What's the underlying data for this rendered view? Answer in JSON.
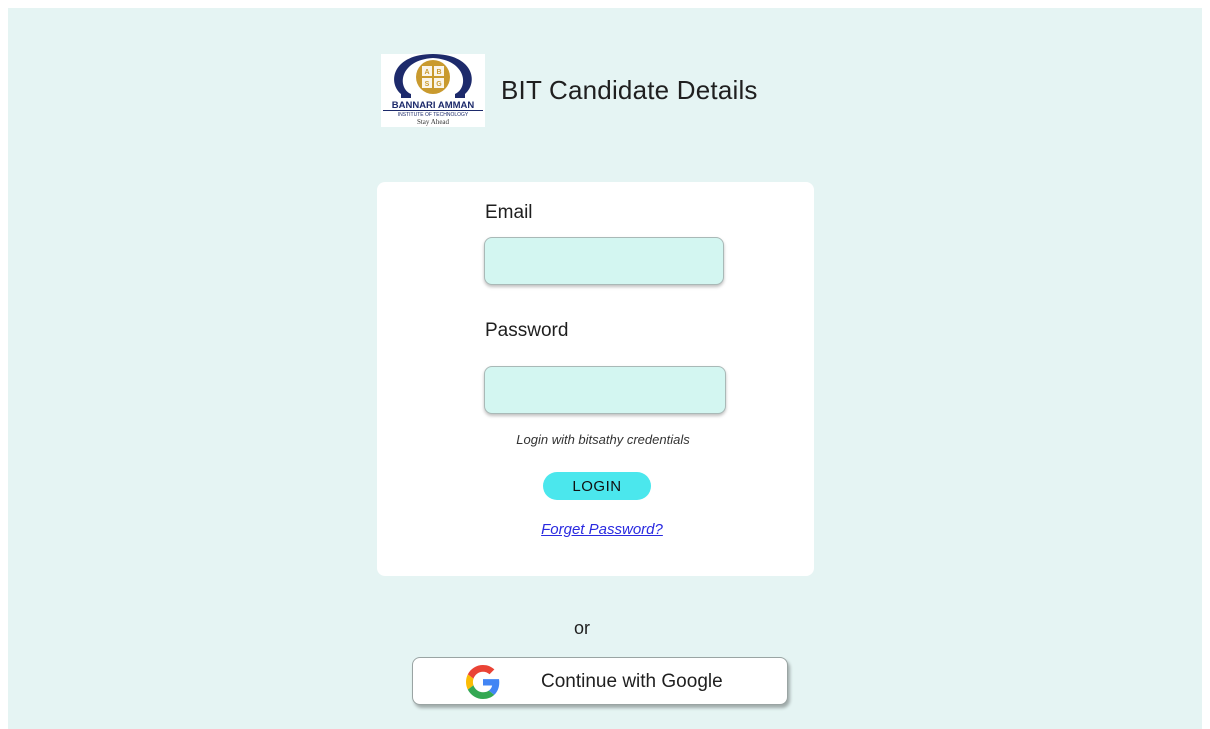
{
  "header": {
    "title": "BIT Candidate Details",
    "logo": {
      "org_name": "BANNARI AMMAN",
      "org_sub": "INSTITUTE OF TECHNOLOGY",
      "tagline": "Stay Ahead",
      "monogram": "ABSG",
      "colors": {
        "arc": "#1d2a6b",
        "emblem": "#c99a2e"
      }
    }
  },
  "login_form": {
    "email_label": "Email",
    "email_value": "",
    "password_label": "Password",
    "password_value": "",
    "hint": "Login with bitsathy credentials",
    "login_label": "LOGIN",
    "forgot_label": "Forget Password?"
  },
  "divider_text": "or",
  "google": {
    "label": "Continue with Google",
    "icon": "google-g-icon"
  },
  "colors": {
    "background": "#e5f4f3",
    "input_fill": "#d3f6f1",
    "login_button": "#4be7ed",
    "link": "#2a2ae0"
  }
}
